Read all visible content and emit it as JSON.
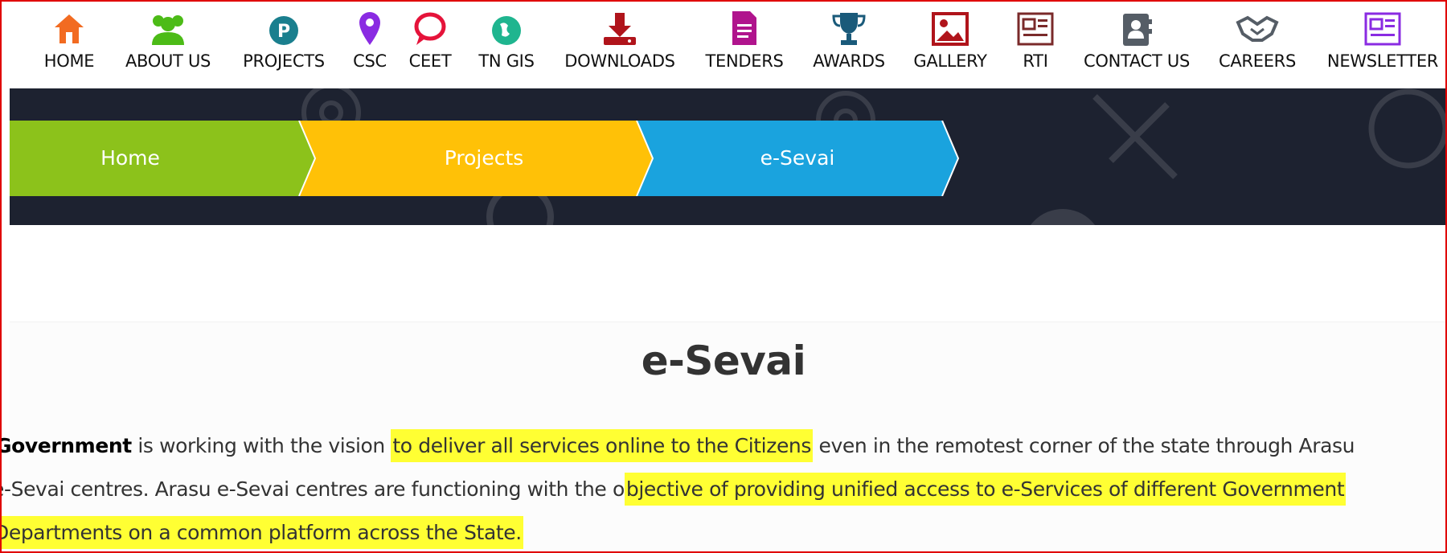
{
  "nav": {
    "items": [
      {
        "label": "HOME",
        "icon": "home-icon",
        "color": "#f26b21"
      },
      {
        "label": "ABOUT US",
        "icon": "group-icon",
        "color": "#4cbb17"
      },
      {
        "label": "PROJECTS",
        "icon": "projects-p-icon",
        "color": "#1a7f8e"
      },
      {
        "label": "CSC",
        "icon": "location-pin-icon",
        "color": "#8a2be2"
      },
      {
        "label": "CEET",
        "icon": "chat-bubble-icon",
        "color": "#e5133a"
      },
      {
        "label": "TN GIS",
        "icon": "globe-icon",
        "color": "#1fb58f"
      },
      {
        "label": "DOWNLOADS",
        "icon": "download-icon",
        "color": "#b0141b"
      },
      {
        "label": "TENDERS",
        "icon": "document-icon",
        "color": "#b0148d"
      },
      {
        "label": "AWARDS",
        "icon": "trophy-icon",
        "color": "#1a5a7a"
      },
      {
        "label": "GALLERY",
        "icon": "picture-icon",
        "color": "#b0141b"
      },
      {
        "label": "RTI",
        "icon": "rti-newspaper-icon",
        "color": "#7a2a2a"
      },
      {
        "label": "CONTACT US",
        "icon": "contact-book-icon",
        "color": "#555d66"
      },
      {
        "label": "CAREERS",
        "icon": "handshake-icon",
        "color": "#555d66"
      },
      {
        "label": "NEWSLETTER",
        "icon": "newsletter-icon",
        "color": "#8a2be2"
      }
    ]
  },
  "breadcrumb": {
    "items": [
      {
        "label": "Home",
        "color": "#8cc21b"
      },
      {
        "label": "Projects",
        "color": "#ffc107"
      },
      {
        "label": "e-Sevai",
        "color": "#1aa3de"
      }
    ]
  },
  "content": {
    "title": "e-Sevai",
    "line1": {
      "strong": "Government",
      "text_a": " is working with the vision ",
      "highlight": "to deliver all services online to the Citizens",
      "text_b": " even in the remotest corner of the state through Arasu"
    },
    "line2": {
      "text_a": "e-Sevai centres. Arasu e-Sevai centres are functioning with the o",
      "highlight": "bjective of providing unified access to e-Services of different Government"
    },
    "line3": {
      "highlight": "Departments on a common platform across the State."
    }
  },
  "colors": {
    "banner_bg": "#1d2230",
    "highlight": "#ffff33",
    "frame_border": "#e00000"
  }
}
